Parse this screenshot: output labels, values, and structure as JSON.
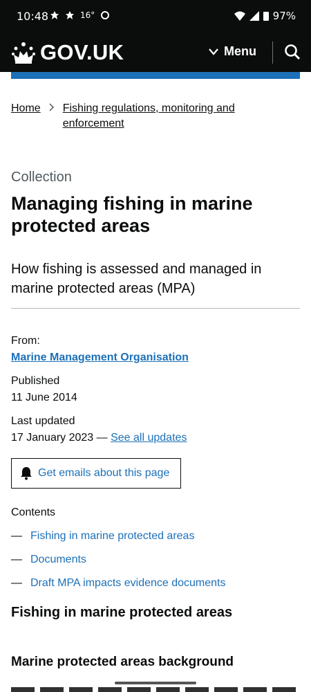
{
  "status_bar": {
    "time": "10:48",
    "temperature": "16°",
    "battery": "97%"
  },
  "header": {
    "logo_text": "GOV.UK",
    "menu_label": "Menu"
  },
  "breadcrumb": {
    "home": "Home",
    "parent": "Fishing regulations, monitoring and enforcement",
    "separator": ">"
  },
  "page": {
    "caption": "Collection",
    "title": "Managing fishing in marine protected areas",
    "lead": "How fishing is assessed and managed in marine protected areas (MPA)"
  },
  "metadata": {
    "from_label": "From:",
    "from_value": "Marine Management Organisation",
    "published_label": "Published",
    "published_value": "11 June 2014",
    "updated_label": "Last updated",
    "updated_value": "17 January 2023 —",
    "see_all_updates": "See all updates"
  },
  "email_button": {
    "label": "Get emails about this page"
  },
  "contents": {
    "label": "Contents",
    "dash": "—",
    "items": [
      "Fishing in marine protected areas",
      "Documents",
      "Draft MPA impacts evidence documents"
    ]
  },
  "sections": {
    "h2": "Fishing in marine protected areas",
    "h3": "Marine protected areas background"
  },
  "colors": {
    "header": "#0b0c0c",
    "link": "#1d70b8",
    "accent_bar": "#1d70b8"
  }
}
